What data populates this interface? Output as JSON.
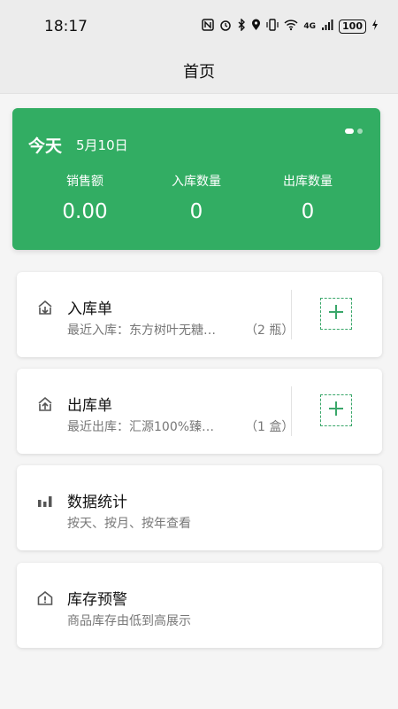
{
  "status_bar": {
    "time": "18:17",
    "network": "4G",
    "battery": "100"
  },
  "header": {
    "title": "首页"
  },
  "summary": {
    "today_label": "今天",
    "date": "5月10日",
    "stats": [
      {
        "label": "销售额",
        "value": "0.00"
      },
      {
        "label": "入库数量",
        "value": "0"
      },
      {
        "label": "出库数量",
        "value": "0"
      }
    ]
  },
  "stock_in": {
    "title": "入库单",
    "recent": "最近入库：东方树叶无糖…",
    "qty": "（2 瓶）"
  },
  "stock_out": {
    "title": "出库单",
    "recent": "最近出库：汇源100%臻…",
    "qty": "（1 盒）"
  },
  "statistics": {
    "title": "数据统计",
    "subtitle": "按天、按月、按年查看"
  },
  "warning": {
    "title": "库存预警",
    "subtitle": "商品库存由低到高展示"
  },
  "colors": {
    "brand_green": "#32ad63"
  }
}
